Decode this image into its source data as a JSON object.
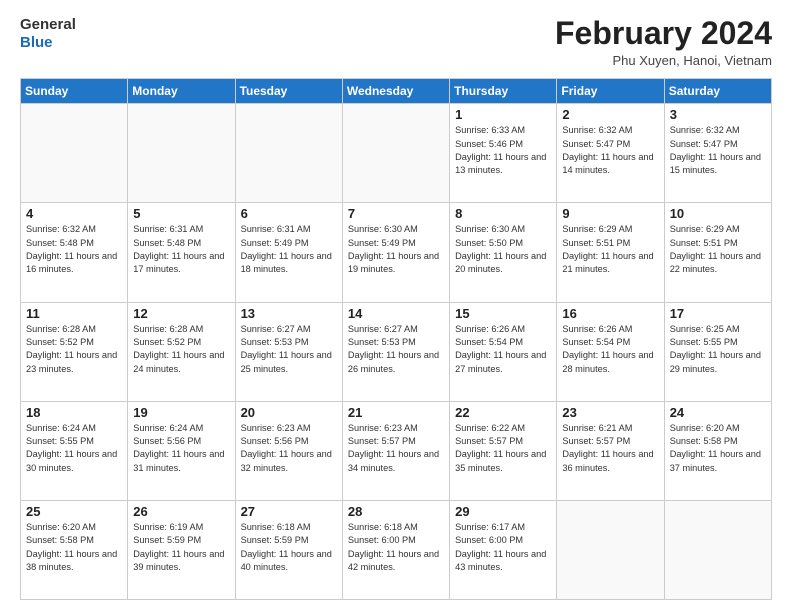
{
  "header": {
    "logo_general": "General",
    "logo_blue": "Blue",
    "month_year": "February 2024",
    "location": "Phu Xuyen, Hanoi, Vietnam"
  },
  "days_of_week": [
    "Sunday",
    "Monday",
    "Tuesday",
    "Wednesday",
    "Thursday",
    "Friday",
    "Saturday"
  ],
  "weeks": [
    [
      {
        "day": "",
        "info": ""
      },
      {
        "day": "",
        "info": ""
      },
      {
        "day": "",
        "info": ""
      },
      {
        "day": "",
        "info": ""
      },
      {
        "day": "1",
        "info": "Sunrise: 6:33 AM\nSunset: 5:46 PM\nDaylight: 11 hours and 13 minutes."
      },
      {
        "day": "2",
        "info": "Sunrise: 6:32 AM\nSunset: 5:47 PM\nDaylight: 11 hours and 14 minutes."
      },
      {
        "day": "3",
        "info": "Sunrise: 6:32 AM\nSunset: 5:47 PM\nDaylight: 11 hours and 15 minutes."
      }
    ],
    [
      {
        "day": "4",
        "info": "Sunrise: 6:32 AM\nSunset: 5:48 PM\nDaylight: 11 hours and 16 minutes."
      },
      {
        "day": "5",
        "info": "Sunrise: 6:31 AM\nSunset: 5:48 PM\nDaylight: 11 hours and 17 minutes."
      },
      {
        "day": "6",
        "info": "Sunrise: 6:31 AM\nSunset: 5:49 PM\nDaylight: 11 hours and 18 minutes."
      },
      {
        "day": "7",
        "info": "Sunrise: 6:30 AM\nSunset: 5:49 PM\nDaylight: 11 hours and 19 minutes."
      },
      {
        "day": "8",
        "info": "Sunrise: 6:30 AM\nSunset: 5:50 PM\nDaylight: 11 hours and 20 minutes."
      },
      {
        "day": "9",
        "info": "Sunrise: 6:29 AM\nSunset: 5:51 PM\nDaylight: 11 hours and 21 minutes."
      },
      {
        "day": "10",
        "info": "Sunrise: 6:29 AM\nSunset: 5:51 PM\nDaylight: 11 hours and 22 minutes."
      }
    ],
    [
      {
        "day": "11",
        "info": "Sunrise: 6:28 AM\nSunset: 5:52 PM\nDaylight: 11 hours and 23 minutes."
      },
      {
        "day": "12",
        "info": "Sunrise: 6:28 AM\nSunset: 5:52 PM\nDaylight: 11 hours and 24 minutes."
      },
      {
        "day": "13",
        "info": "Sunrise: 6:27 AM\nSunset: 5:53 PM\nDaylight: 11 hours and 25 minutes."
      },
      {
        "day": "14",
        "info": "Sunrise: 6:27 AM\nSunset: 5:53 PM\nDaylight: 11 hours and 26 minutes."
      },
      {
        "day": "15",
        "info": "Sunrise: 6:26 AM\nSunset: 5:54 PM\nDaylight: 11 hours and 27 minutes."
      },
      {
        "day": "16",
        "info": "Sunrise: 6:26 AM\nSunset: 5:54 PM\nDaylight: 11 hours and 28 minutes."
      },
      {
        "day": "17",
        "info": "Sunrise: 6:25 AM\nSunset: 5:55 PM\nDaylight: 11 hours and 29 minutes."
      }
    ],
    [
      {
        "day": "18",
        "info": "Sunrise: 6:24 AM\nSunset: 5:55 PM\nDaylight: 11 hours and 30 minutes."
      },
      {
        "day": "19",
        "info": "Sunrise: 6:24 AM\nSunset: 5:56 PM\nDaylight: 11 hours and 31 minutes."
      },
      {
        "day": "20",
        "info": "Sunrise: 6:23 AM\nSunset: 5:56 PM\nDaylight: 11 hours and 32 minutes."
      },
      {
        "day": "21",
        "info": "Sunrise: 6:23 AM\nSunset: 5:57 PM\nDaylight: 11 hours and 34 minutes."
      },
      {
        "day": "22",
        "info": "Sunrise: 6:22 AM\nSunset: 5:57 PM\nDaylight: 11 hours and 35 minutes."
      },
      {
        "day": "23",
        "info": "Sunrise: 6:21 AM\nSunset: 5:57 PM\nDaylight: 11 hours and 36 minutes."
      },
      {
        "day": "24",
        "info": "Sunrise: 6:20 AM\nSunset: 5:58 PM\nDaylight: 11 hours and 37 minutes."
      }
    ],
    [
      {
        "day": "25",
        "info": "Sunrise: 6:20 AM\nSunset: 5:58 PM\nDaylight: 11 hours and 38 minutes."
      },
      {
        "day": "26",
        "info": "Sunrise: 6:19 AM\nSunset: 5:59 PM\nDaylight: 11 hours and 39 minutes."
      },
      {
        "day": "27",
        "info": "Sunrise: 6:18 AM\nSunset: 5:59 PM\nDaylight: 11 hours and 40 minutes."
      },
      {
        "day": "28",
        "info": "Sunrise: 6:18 AM\nSunset: 6:00 PM\nDaylight: 11 hours and 42 minutes."
      },
      {
        "day": "29",
        "info": "Sunrise: 6:17 AM\nSunset: 6:00 PM\nDaylight: 11 hours and 43 minutes."
      },
      {
        "day": "",
        "info": ""
      },
      {
        "day": "",
        "info": ""
      }
    ]
  ]
}
